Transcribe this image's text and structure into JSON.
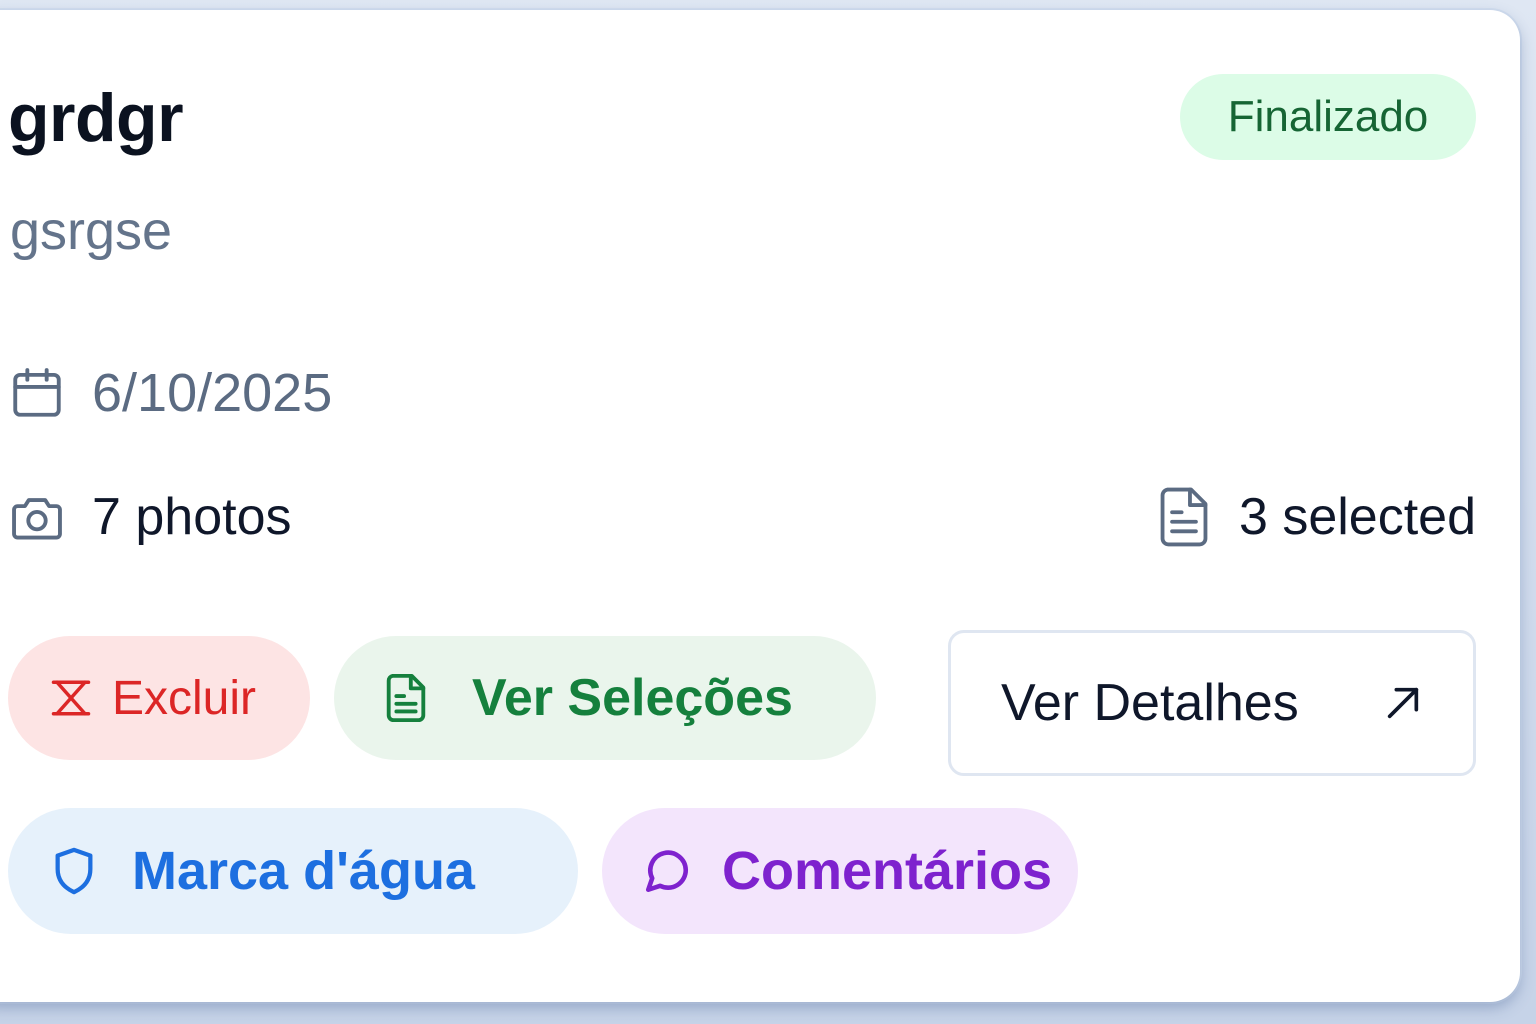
{
  "project": {
    "title": "grdgr",
    "subtitle": "gsrgse",
    "status": "Finalizado",
    "date": "6/10/2025",
    "photos": "7 photos",
    "selected": "3 selected"
  },
  "actions": {
    "delete_label": "Excluir",
    "selections_label": "Ver Seleções",
    "details_label": "Ver Detalhes",
    "watermark_label": "Marca d'água",
    "comments_label": "Comentários"
  },
  "icons": {
    "date": "calendar-icon",
    "photos": "camera-icon",
    "selected": "document-icon",
    "delete": "x-icon",
    "selections": "file-text-icon",
    "details": "arrow-up-right-icon",
    "watermark": "shield-icon",
    "comments": "message-circle-icon"
  },
  "colors": {
    "status_bg": "#dcfce7",
    "status_text": "#166534",
    "delete": "#dc2626",
    "selections": "#15803d",
    "watermark": "#1d6fe0",
    "comments": "#7e22ce"
  }
}
